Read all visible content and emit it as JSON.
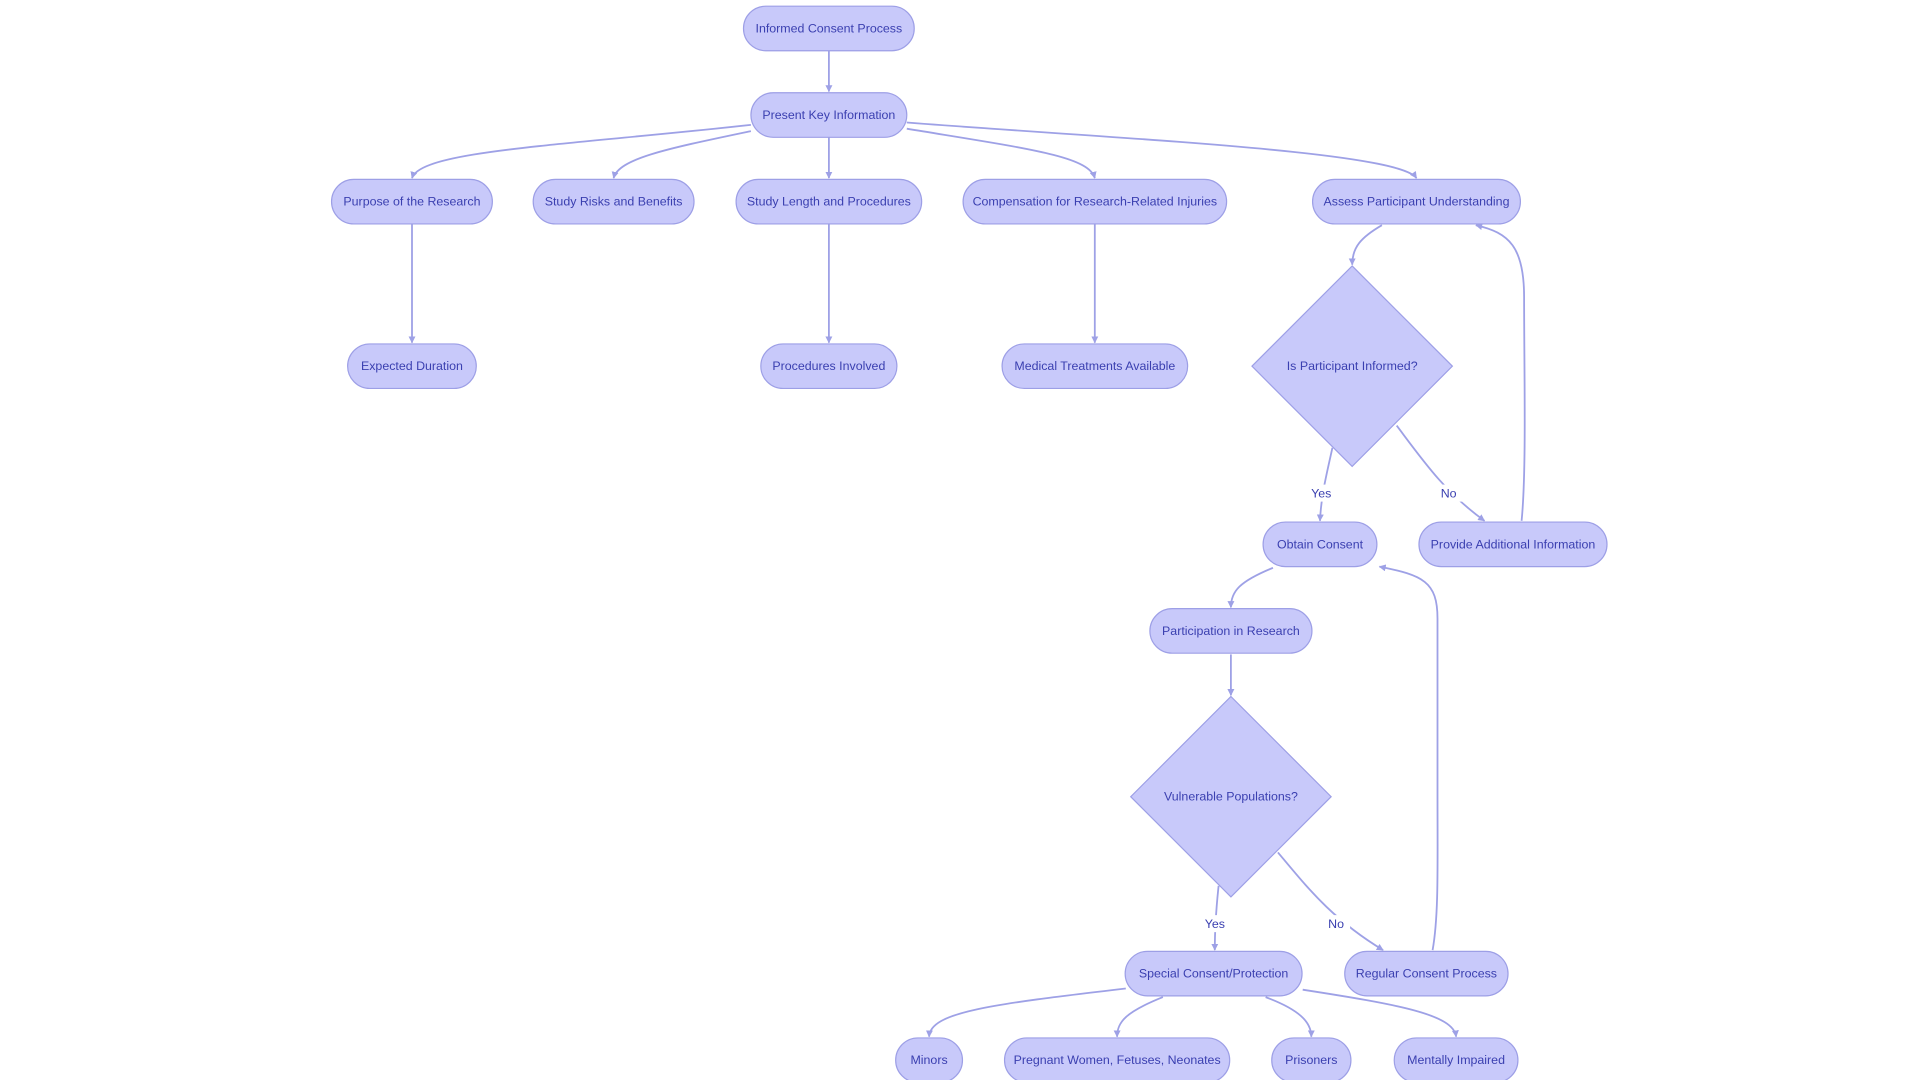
{
  "diagram": {
    "type": "flowchart",
    "colors": {
      "node_fill": "#c8c9fa",
      "node_stroke": "#9d9fe6",
      "edge": "#9ea1e6",
      "text": "#3a3fb0",
      "background": "#ffffff"
    },
    "nodes": [
      {
        "id": "informed_consent_process",
        "label": "Informed Consent Process",
        "shape": "stadium"
      },
      {
        "id": "present_key_information",
        "label": "Present Key Information",
        "shape": "stadium"
      },
      {
        "id": "purpose_of_research",
        "label": "Purpose of the Research",
        "shape": "stadium"
      },
      {
        "id": "study_risks_benefits",
        "label": "Study Risks and Benefits",
        "shape": "stadium"
      },
      {
        "id": "study_length_procedures",
        "label": "Study Length and Procedures",
        "shape": "stadium"
      },
      {
        "id": "compensation_injuries",
        "label": "Compensation for Research-Related Injuries",
        "shape": "stadium"
      },
      {
        "id": "assess_understanding",
        "label": "Assess Participant Understanding",
        "shape": "stadium"
      },
      {
        "id": "expected_duration",
        "label": "Expected Duration",
        "shape": "stadium"
      },
      {
        "id": "procedures_involved",
        "label": "Procedures Involved",
        "shape": "stadium"
      },
      {
        "id": "medical_treatments",
        "label": "Medical Treatments Available",
        "shape": "stadium"
      },
      {
        "id": "is_informed",
        "label": "Is Participant Informed?",
        "shape": "diamond"
      },
      {
        "id": "obtain_consent",
        "label": "Obtain Consent",
        "shape": "stadium"
      },
      {
        "id": "provide_additional_info",
        "label": "Provide Additional Information",
        "shape": "stadium"
      },
      {
        "id": "participation",
        "label": "Participation in Research",
        "shape": "stadium"
      },
      {
        "id": "vulnerable_populations",
        "label": "Vulnerable Populations?",
        "shape": "diamond"
      },
      {
        "id": "special_consent",
        "label": "Special Consent/Protection",
        "shape": "stadium"
      },
      {
        "id": "regular_consent",
        "label": "Regular Consent Process",
        "shape": "stadium"
      },
      {
        "id": "minors",
        "label": "Minors",
        "shape": "stadium"
      },
      {
        "id": "pregnant_women",
        "label": "Pregnant Women, Fetuses, Neonates",
        "shape": "stadium"
      },
      {
        "id": "prisoners",
        "label": "Prisoners",
        "shape": "stadium"
      },
      {
        "id": "mentally_impaired",
        "label": "Mentally Impaired",
        "shape": "stadium"
      }
    ],
    "edges": [
      {
        "from": "informed_consent_process",
        "to": "present_key_information",
        "label": ""
      },
      {
        "from": "present_key_information",
        "to": "purpose_of_research",
        "label": ""
      },
      {
        "from": "present_key_information",
        "to": "study_risks_benefits",
        "label": ""
      },
      {
        "from": "present_key_information",
        "to": "study_length_procedures",
        "label": ""
      },
      {
        "from": "present_key_information",
        "to": "compensation_injuries",
        "label": ""
      },
      {
        "from": "present_key_information",
        "to": "assess_understanding",
        "label": ""
      },
      {
        "from": "purpose_of_research",
        "to": "expected_duration",
        "label": ""
      },
      {
        "from": "study_length_procedures",
        "to": "procedures_involved",
        "label": ""
      },
      {
        "from": "compensation_injuries",
        "to": "medical_treatments",
        "label": ""
      },
      {
        "from": "assess_understanding",
        "to": "is_informed",
        "label": ""
      },
      {
        "from": "is_informed",
        "to": "obtain_consent",
        "label": "Yes"
      },
      {
        "from": "is_informed",
        "to": "provide_additional_info",
        "label": "No"
      },
      {
        "from": "provide_additional_info",
        "to": "assess_understanding",
        "label": ""
      },
      {
        "from": "obtain_consent",
        "to": "participation",
        "label": ""
      },
      {
        "from": "participation",
        "to": "vulnerable_populations",
        "label": ""
      },
      {
        "from": "vulnerable_populations",
        "to": "special_consent",
        "label": "Yes"
      },
      {
        "from": "vulnerable_populations",
        "to": "regular_consent",
        "label": "No"
      },
      {
        "from": "regular_consent",
        "to": "obtain_consent",
        "label": ""
      },
      {
        "from": "special_consent",
        "to": "minors",
        "label": ""
      },
      {
        "from": "special_consent",
        "to": "pregnant_women",
        "label": ""
      },
      {
        "from": "special_consent",
        "to": "prisoners",
        "label": ""
      },
      {
        "from": "special_consent",
        "to": "mentally_impaired",
        "label": ""
      }
    ]
  }
}
